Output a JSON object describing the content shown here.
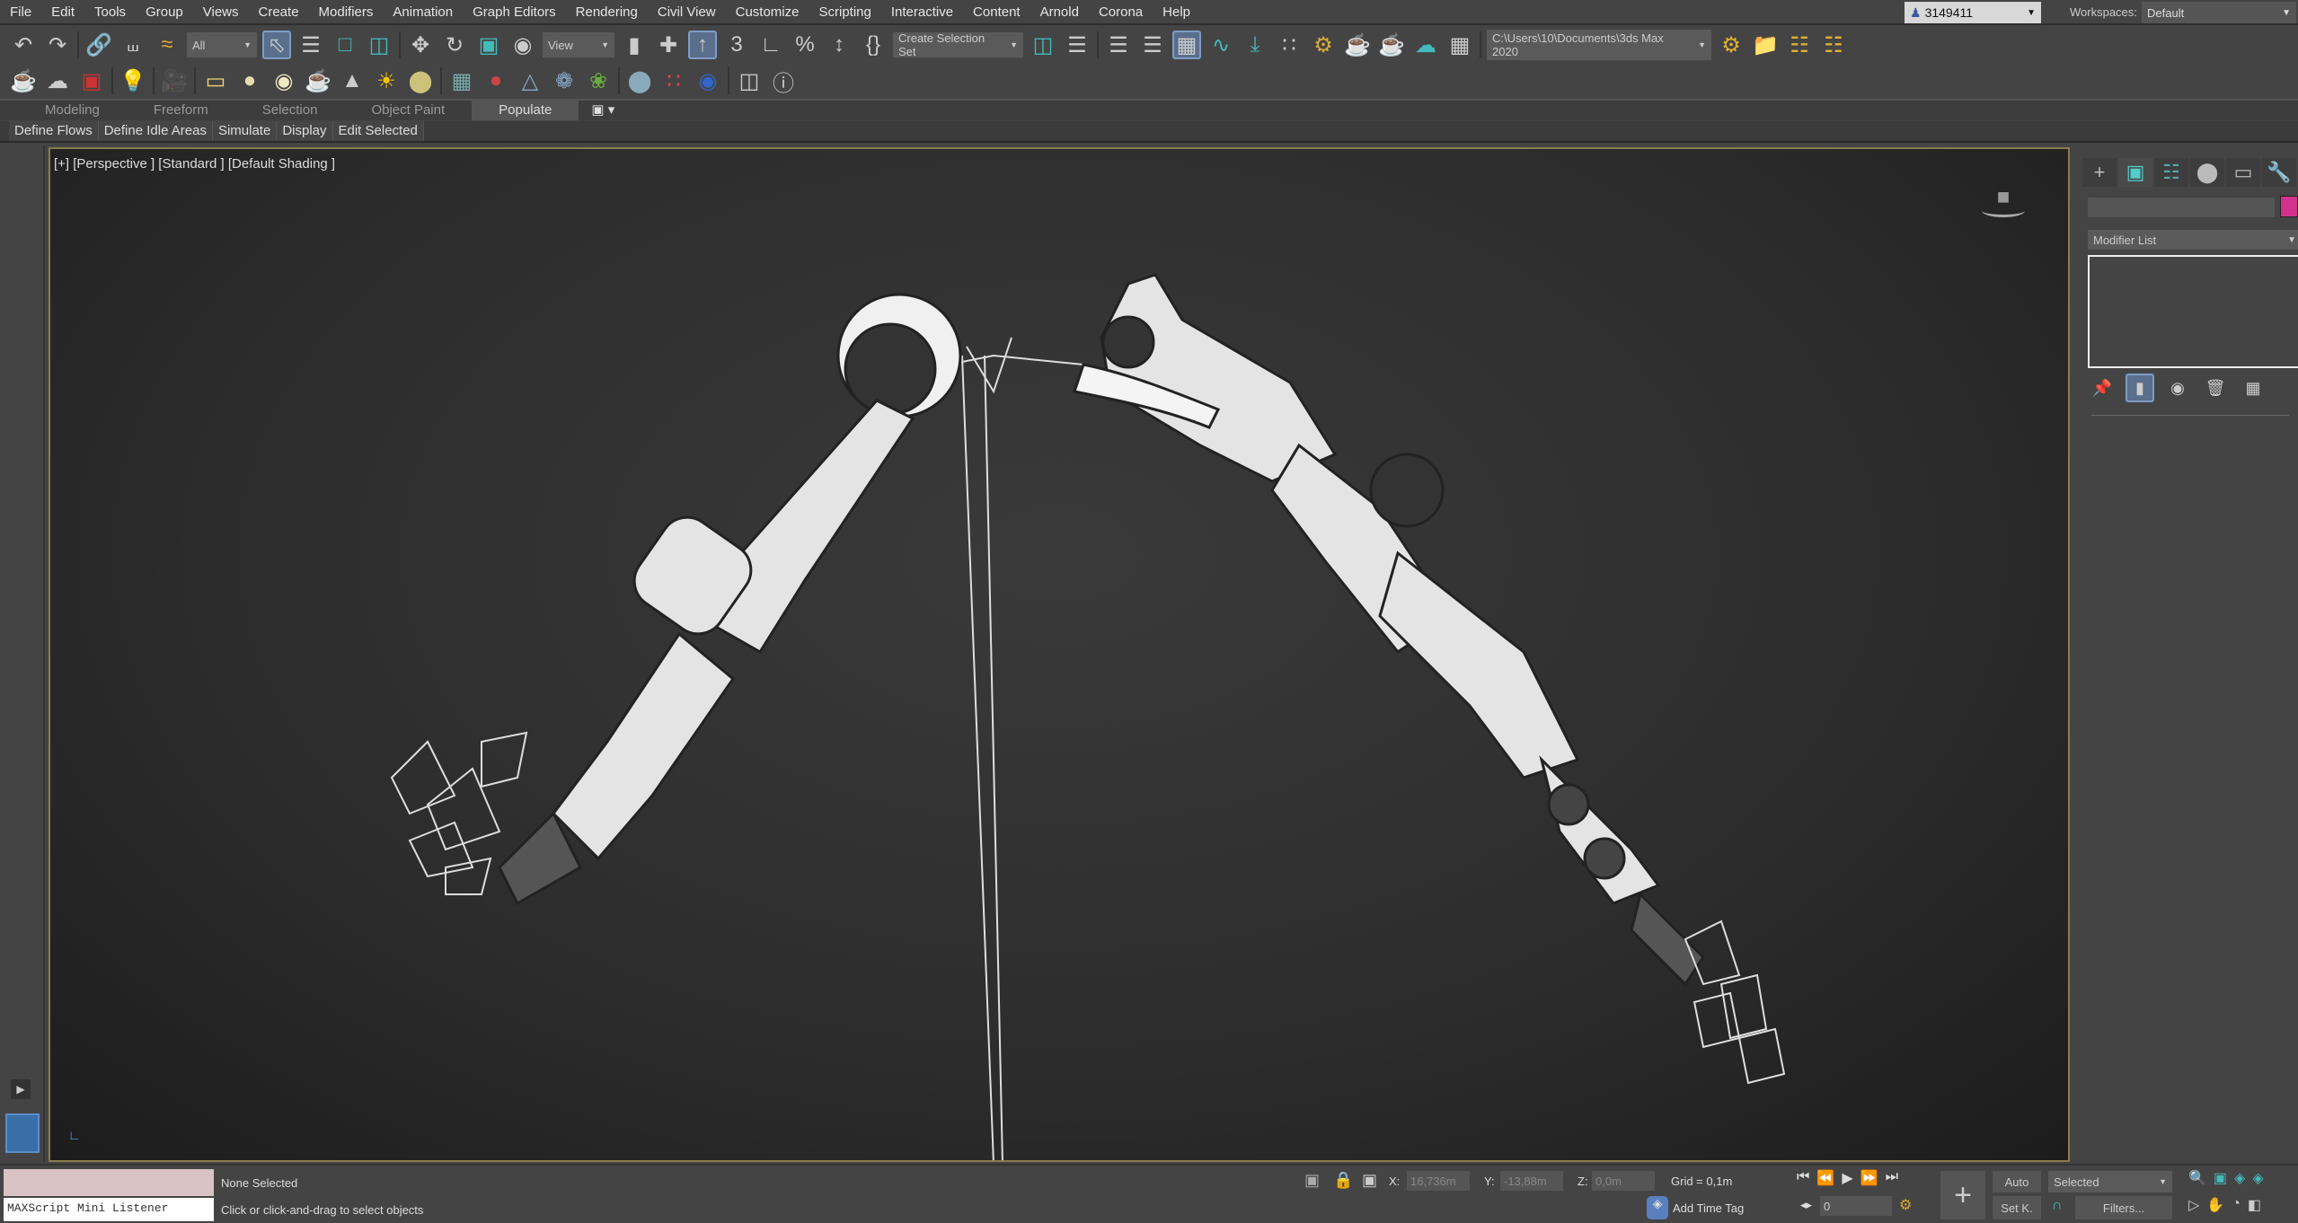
{
  "menu": [
    "File",
    "Edit",
    "Tools",
    "Group",
    "Views",
    "Create",
    "Modifiers",
    "Animation",
    "Graph Editors",
    "Rendering",
    "Civil View",
    "Customize",
    "Scripting",
    "Interactive",
    "Content",
    "Arnold",
    "Corona",
    "Help"
  ],
  "user": {
    "id": "3149411"
  },
  "workspaces": {
    "label": "Workspaces:",
    "value": "Default"
  },
  "toolbar": {
    "selection_filter": "All",
    "reference_coord": "View",
    "selection_set": "Create Selection Set",
    "project_path": "C:\\Users\\10\\Documents\\3ds Max 2020"
  },
  "ribbon": {
    "tabs": [
      "Modeling",
      "Freeform",
      "Selection",
      "Object Paint",
      "Populate"
    ],
    "active_tab": "Populate",
    "subtabs": [
      "Define Flows",
      "Define Idle Areas",
      "Simulate",
      "Display",
      "Edit Selected"
    ]
  },
  "viewport": {
    "label": "[+] [Perspective ] [Standard ] [Default Shading ]"
  },
  "command_panel": {
    "tabs": [
      "create",
      "modify",
      "hierarchy",
      "motion",
      "display",
      "utilities"
    ],
    "active_tab": "modify",
    "object_color": "#d4308e",
    "modifier_list": "Modifier List"
  },
  "status": {
    "listener": "MAXScript Mini Listener",
    "selection": "None Selected",
    "prompt": "Click or click-and-drag to select objects",
    "x": "16,736m",
    "y": "-13,88m",
    "z": "0,0m",
    "grid": "Grid = 0,1m",
    "add_time_tag": "Add Time Tag",
    "frame": "0",
    "auto_key": "Auto",
    "set_key": "Set K.",
    "key_filter": "Selected",
    "filters": "Filters..."
  },
  "labels": {
    "x": "X:",
    "y": "Y:",
    "z": "Z:"
  }
}
